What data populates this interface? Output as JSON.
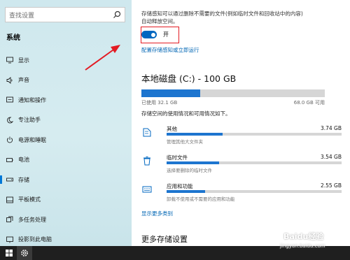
{
  "search": {
    "placeholder": "查找设置"
  },
  "sidebar": {
    "title": "系统",
    "items": [
      {
        "label": "显示",
        "icon": "monitor-icon"
      },
      {
        "label": "声音",
        "icon": "speaker-icon"
      },
      {
        "label": "通知和操作",
        "icon": "notification-icon"
      },
      {
        "label": "专注助手",
        "icon": "moon-icon"
      },
      {
        "label": "电源和睡眠",
        "icon": "power-icon"
      },
      {
        "label": "电池",
        "icon": "battery-icon"
      },
      {
        "label": "存储",
        "icon": "storage-icon",
        "active": true
      },
      {
        "label": "平板模式",
        "icon": "tablet-icon"
      },
      {
        "label": "多任务处理",
        "icon": "multitask-icon"
      },
      {
        "label": "投影到此电脑",
        "icon": "projection-icon"
      }
    ]
  },
  "storage_sense": {
    "description_line1": "存储感知可以通过删除不需要的文件(例如临时文件和回收站中的内容)",
    "description_line2": "自动释放空间。",
    "toggle_label": "开",
    "toggle_on": true,
    "configure_link": "配置存储感知或立即运行"
  },
  "drive": {
    "title": "本地磁盘 (C:) - 100 GB",
    "used_label": "已使用 32.1 GB",
    "free_label": "68.0 GB 可用",
    "used_fraction": 0.321,
    "description": "存储空间的使用情况和可用情况如下。"
  },
  "categories": [
    {
      "name": "其他",
      "size": "3.74 GB",
      "subtitle": "管理其他大文件夹",
      "icon": "other-files-icon",
      "fraction": 0.32
    },
    {
      "name": "临时文件",
      "size": "3.54 GB",
      "subtitle": "选择要删除的临时文件",
      "icon": "trash-icon",
      "fraction": 0.3
    },
    {
      "name": "应用和功能",
      "size": "2.55 GB",
      "subtitle": "卸载不使用或不需要的应用和功能",
      "icon": "apps-icon",
      "fraction": 0.22
    }
  ],
  "show_more_link": "显示更多类别",
  "more_settings_title": "更多存储设置",
  "watermark": {
    "main": "Baidu经验",
    "sub": "jingyan.baidu.com"
  },
  "colors": {
    "accent": "#0067c0",
    "highlight_box": "#e31b23",
    "arrow": "#e31b23"
  }
}
